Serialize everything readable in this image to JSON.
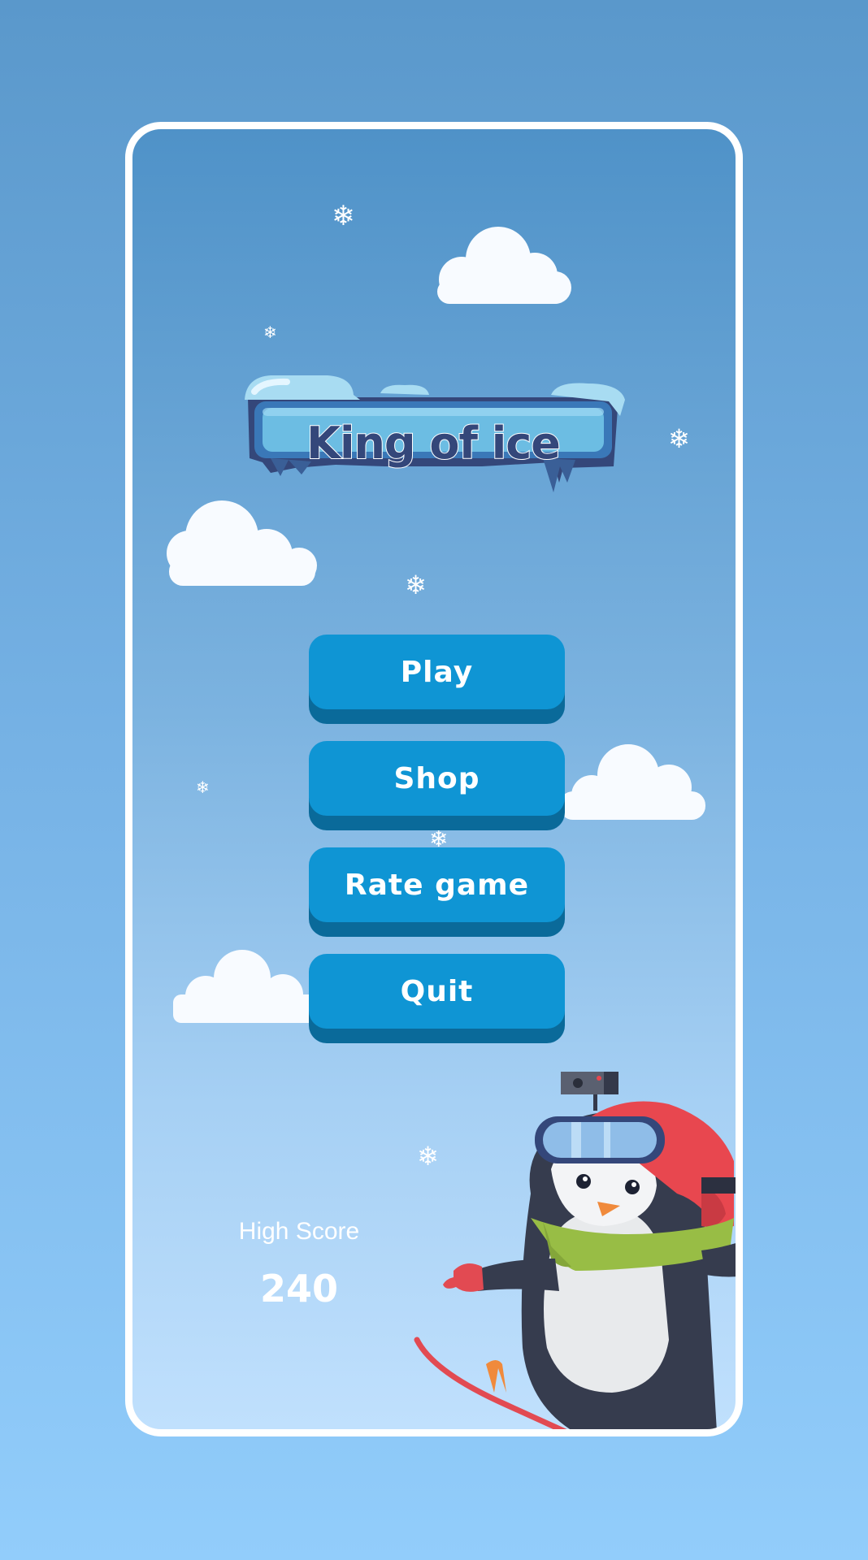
{
  "game": {
    "title": "King of ice"
  },
  "menu": {
    "play_label": "Play",
    "shop_label": "Shop",
    "rate_label": "Rate game",
    "quit_label": "Quit"
  },
  "score": {
    "high_score_label": "High Score",
    "high_score_value": "240"
  },
  "colors": {
    "background_top": "#5a98cb",
    "background_bottom": "#92cdfb",
    "button_face": "#0f95d4",
    "button_shadow": "#0a6a9a",
    "title_text": "#34477a",
    "frame_border": "#ffffff"
  },
  "icons": [
    "snowflake-icon",
    "cloud",
    "penguin-snowboarder"
  ]
}
